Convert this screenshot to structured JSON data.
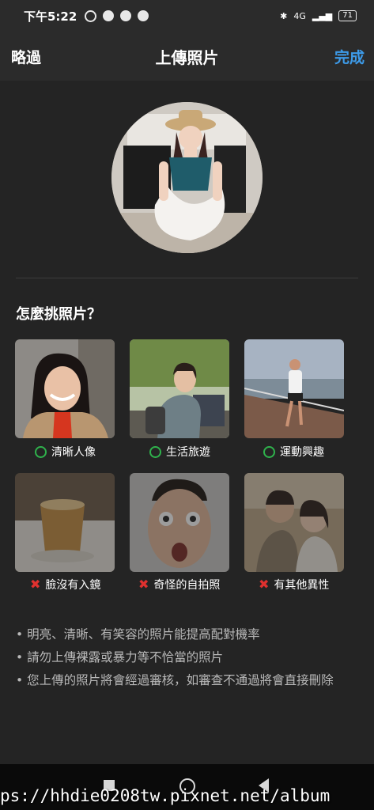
{
  "status_bar": {
    "time": "下午5:22",
    "network": "4G",
    "battery": "71"
  },
  "header": {
    "skip_label": "略過",
    "title": "上傳照片",
    "done_label": "完成"
  },
  "section_title": "怎麼挑照片？",
  "good_examples": [
    {
      "label": "清晰人像"
    },
    {
      "label": "生活旅遊"
    },
    {
      "label": "運動興趣"
    }
  ],
  "bad_examples": [
    {
      "label": "臉沒有入鏡"
    },
    {
      "label": "奇怪的自拍照"
    },
    {
      "label": "有其他異性"
    }
  ],
  "tips": [
    "• 明亮、清晰、有笑容的照片能提高配對機率",
    "• 請勿上傳裸露或暴力等不恰當的照片",
    "• 您上傳的照片將會經過審核，如審查不通過將會直接刪除"
  ],
  "watermark": "ps://hhdie0208tw.pixnet.net/album",
  "colors": {
    "accent": "#3d9be9",
    "ok": "#2fb24c",
    "bad": "#e0312f"
  }
}
